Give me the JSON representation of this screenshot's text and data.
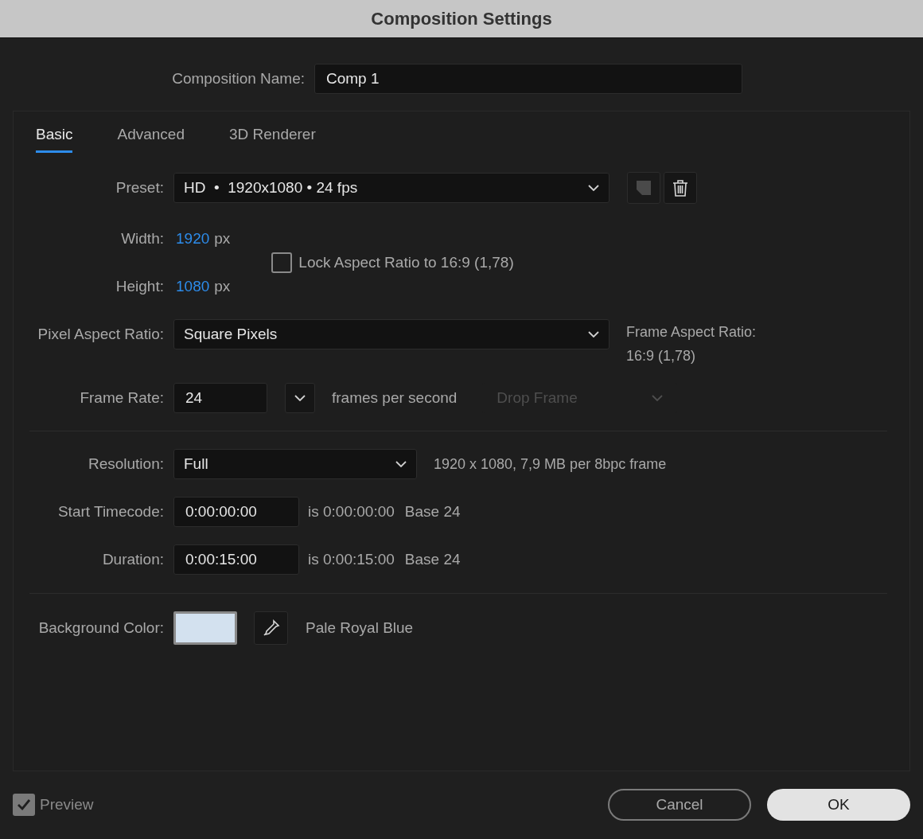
{
  "window": {
    "title": "Composition Settings"
  },
  "composition_name": {
    "label": "Composition Name:",
    "value": "Comp 1"
  },
  "tabs": [
    {
      "label": "Basic",
      "selected": true
    },
    {
      "label": "Advanced",
      "selected": false
    },
    {
      "label": "3D Renderer",
      "selected": false
    }
  ],
  "preset": {
    "label": "Preset:",
    "value": "HD  •  1920x1080 • 24 fps"
  },
  "width": {
    "label": "Width:",
    "value": "1920",
    "unit": "px"
  },
  "height": {
    "label": "Height:",
    "value": "1080",
    "unit": "px"
  },
  "lock_aspect": {
    "label": "Lock Aspect Ratio to 16:9 (1,78)",
    "checked": false
  },
  "pixel_aspect_ratio": {
    "label": "Pixel Aspect Ratio:",
    "value": "Square Pixels"
  },
  "frame_aspect_ratio": {
    "label": "Frame Aspect Ratio:",
    "value": "16:9 (1,78)"
  },
  "frame_rate": {
    "label": "Frame Rate:",
    "value": "24",
    "unit": "frames per second"
  },
  "drop_frame": {
    "value": "Drop Frame",
    "disabled": true
  },
  "resolution": {
    "label": "Resolution:",
    "value": "Full",
    "info": "1920 x 1080, 7,9 MB per 8bpc frame"
  },
  "start_timecode": {
    "label": "Start Timecode:",
    "value": "0:00:00:00",
    "is": "is 0:00:00:00",
    "base": "Base 24"
  },
  "duration": {
    "label": "Duration:",
    "value": "0:00:15:00",
    "is": "is 0:00:15:00",
    "base": "Base 24"
  },
  "background_color": {
    "label": "Background Color:",
    "color": "#d3e1ef",
    "name": "Pale Royal Blue"
  },
  "preview": {
    "label": "Preview",
    "checked": true
  },
  "buttons": [
    {
      "label": "Cancel",
      "kind": "secondary"
    },
    {
      "label": "OK",
      "kind": "primary"
    }
  ]
}
